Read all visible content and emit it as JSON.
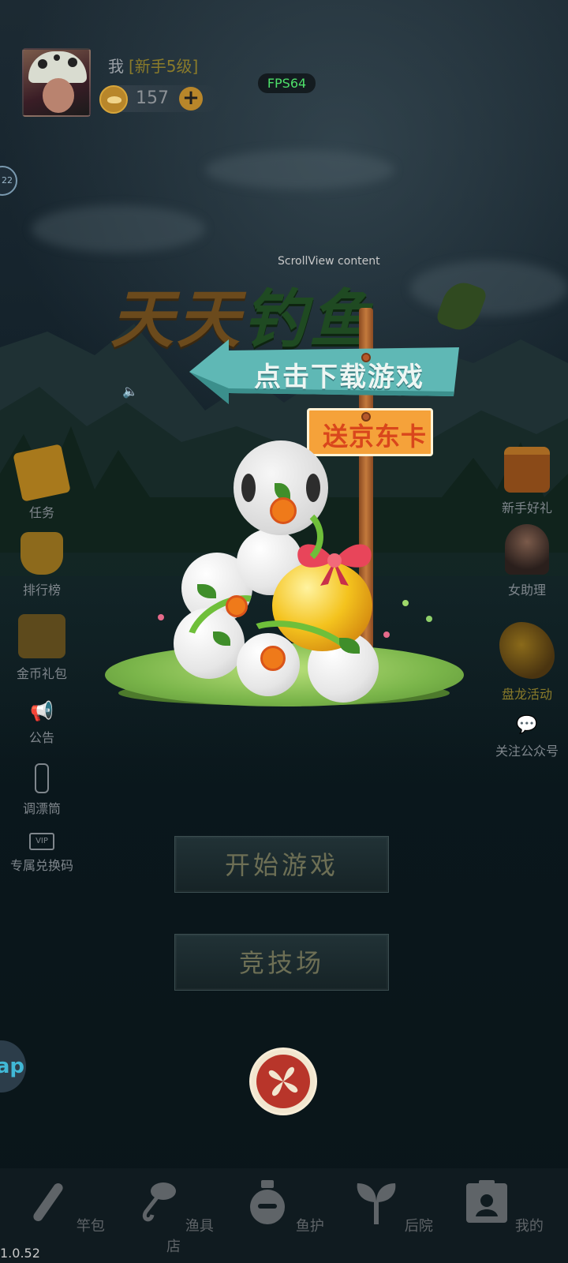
{
  "header": {
    "user_name": "我",
    "user_level": "[新手5级]",
    "coins": "157",
    "coin_add_label": "+",
    "fps_label": "FPS64",
    "side_badge_text": "22"
  },
  "overlay": {
    "scrollview_label": "ScrollView content",
    "logo_text_a": "天天",
    "logo_text_b": "钓鱼"
  },
  "promo": {
    "arrow_sign_label": "点击下载游戏",
    "gift_sign_label": "送京东卡"
  },
  "left_menu": [
    {
      "label": "任务",
      "icon": "task-scroll-icon"
    },
    {
      "label": "排行榜",
      "icon": "trophy-icon"
    },
    {
      "label": "金币礼包",
      "icon": "coin-pack-icon"
    },
    {
      "label": "公告",
      "icon": "megaphone-icon"
    },
    {
      "label": "调漂筒",
      "icon": "float-tube-icon"
    },
    {
      "label": "专属兑换码",
      "icon": "vip-code-icon"
    }
  ],
  "right_menu": [
    {
      "label": "新手好礼",
      "icon": "gift-box-icon"
    },
    {
      "label": "女助理",
      "icon": "assistant-avatar-icon"
    },
    {
      "label": "盘龙活动",
      "icon": "dragon-icon"
    },
    {
      "label": "关注公众号",
      "icon": "wechat-icon"
    }
  ],
  "main_buttons": {
    "start_game": "开始游戏",
    "arena": "竞技场"
  },
  "ap_button": "ap",
  "bottom_tabs": [
    {
      "label": "竿包",
      "icon": "rod-bag-icon"
    },
    {
      "label": "渔具店",
      "icon": "fishing-shop-icon"
    },
    {
      "label": "鱼护",
      "icon": "fish-keeper-icon"
    },
    {
      "label": "后院",
      "icon": "sprout-icon"
    },
    {
      "label": "我的",
      "icon": "profile-icon"
    }
  ],
  "version": "1.0.52",
  "colors": {
    "fps_green": "#4ee06a",
    "sign_teal": "#5fb8b5",
    "sign_orange": "#f5a23a",
    "close_red": "#b8352a"
  }
}
